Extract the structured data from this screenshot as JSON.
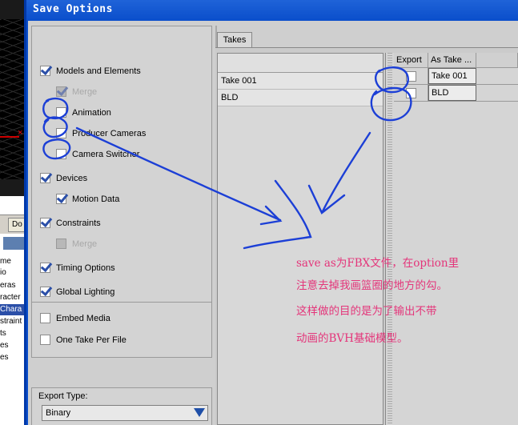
{
  "window": {
    "title": "Save Options"
  },
  "background_app": {
    "tab_label": "Do",
    "list_items": [
      "me",
      "io",
      "eras",
      "racter",
      "Chara",
      "straint",
      "ts",
      "es",
      "es"
    ]
  },
  "options": {
    "models_elements": {
      "label": "Models and Elements",
      "checked": true
    },
    "merge_models": {
      "label": "Merge",
      "checked": true,
      "enabled": false
    },
    "animation": {
      "label": "Animation",
      "checked": false
    },
    "producer_cameras": {
      "label": "Producer Cameras",
      "checked": false
    },
    "camera_switcher": {
      "label": "Camera Switcher",
      "checked": false
    },
    "devices": {
      "label": "Devices",
      "checked": true
    },
    "motion_data": {
      "label": "Motion Data",
      "checked": true
    },
    "constraints": {
      "label": "Constraints",
      "checked": true
    },
    "merge_constraints": {
      "label": "Merge",
      "checked": false,
      "enabled": false
    },
    "timing_options": {
      "label": "Timing Options",
      "checked": true
    },
    "global_lighting": {
      "label": "Global Lighting",
      "checked": true
    },
    "embed_media": {
      "label": "Embed Media",
      "checked": false
    },
    "one_take_per_file": {
      "label": "One Take Per File",
      "checked": false
    }
  },
  "export_type": {
    "label": "Export Type:",
    "value": "Binary"
  },
  "takes": {
    "tab_label": "Takes",
    "columns": {
      "export": "Export",
      "as_take": "As Take ..."
    },
    "rows": [
      {
        "name": "Take 001",
        "export": false,
        "as_take": "Take 001"
      },
      {
        "name": "BLD",
        "export": false,
        "as_take": "BLD"
      }
    ]
  },
  "annotation": {
    "color": "#e4357a",
    "stroke_color": "#1c3fd6",
    "lines": [
      "save as为FBX文件，在option里",
      "注意去掉我画篮圈的地方的勾。",
      "这样做的目的是为了输出不带",
      "动画的BVH基础模型。"
    ]
  }
}
